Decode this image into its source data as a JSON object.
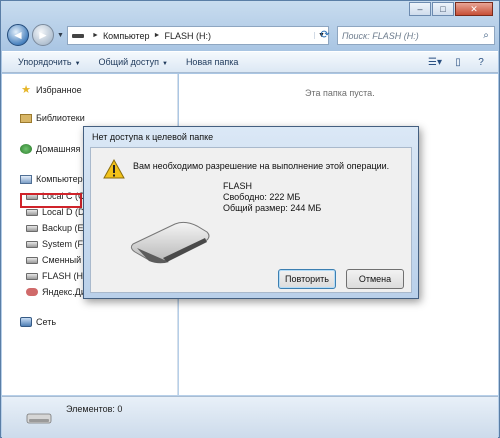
{
  "window": {
    "caption_buttons": [
      "–",
      "□",
      "✕"
    ]
  },
  "address_bar": {
    "path": [
      "Компьютер",
      "FLASH (H:)"
    ],
    "separator": "►"
  },
  "search": {
    "placeholder": "Поиск: FLASH (H:)"
  },
  "toolbar": {
    "organize": "Упорядочить",
    "share": "Общий доступ",
    "new_folder": "Новая папка"
  },
  "nav_pane": {
    "favorites": "Избранное",
    "libraries": "Библиотеки",
    "homegroup": "Домашняя г",
    "computer": "Компьютер",
    "drives": [
      "Local C (C:)",
      "Local D (D:)",
      "Backup (E:)",
      "System (F:)",
      "Сменный (",
      "FLASH (H:)",
      "Яндекс.Дис"
    ],
    "network": "Сеть",
    "selected_drive": "FLASH (H:)"
  },
  "content": {
    "empty_message": "Эта папка пуста."
  },
  "status": {
    "items": "Элементов: 0"
  },
  "dialog": {
    "title": "Нет доступа к целевой папке",
    "message": "Вам необходимо разрешение на выполнение этой операции.",
    "drive_name": "FLASH",
    "free": "Свободно: 222 МБ",
    "total": "Общий размер: 244 МБ",
    "retry": "Повторить",
    "cancel": "Отмена"
  },
  "colors": {
    "accent": "#3c7fb1",
    "selection_highlight": "#d0232a",
    "warning": "#f2c21a"
  }
}
